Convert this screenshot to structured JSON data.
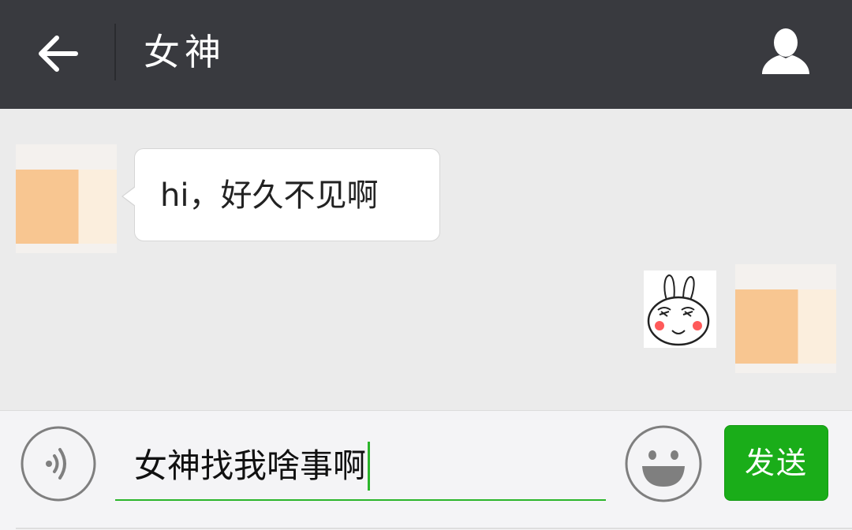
{
  "header": {
    "title": "女神",
    "back_icon": "arrow-left-icon",
    "profile_icon": "user-icon"
  },
  "messages": [
    {
      "side": "left",
      "type": "text",
      "text": "hi，好久不见啊"
    },
    {
      "side": "right",
      "type": "sticker",
      "sticker": "bunny-face-sticker"
    }
  ],
  "input": {
    "value": "女神找我啥事啊",
    "voice_icon": "voice-wave-icon",
    "emoji_icon": "smiley-face-icon",
    "send_label": "发送"
  },
  "colors": {
    "header_bg": "#393a3f",
    "chat_bg": "#ebebeb",
    "accent_green": "#1aad19",
    "bubble_bg": "#ffffff"
  }
}
